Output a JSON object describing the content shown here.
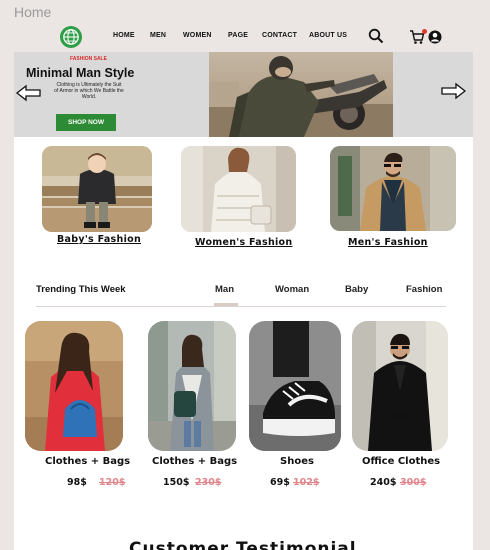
{
  "page_label": "Home",
  "nav": {
    "logo_icon": "globe-icon",
    "items": [
      "HOME",
      "MEN",
      "WOMEN",
      "PAGE",
      "CONTACT",
      "ABOUT US"
    ],
    "search_icon": "search-icon",
    "cart_icon": "cart-icon",
    "user_icon": "user-icon"
  },
  "hero": {
    "tag": "FASHION SALE",
    "title": "Minimal Man Style",
    "subtitle": "Clothing is Ultimately the Suit of Armor in which We Battle the World.",
    "button": "SHOP NOW",
    "prev_icon": "arrow-left-icon",
    "next_icon": "arrow-right-icon"
  },
  "categories": [
    "Baby's Fashion",
    "Women's Fashion",
    "Men's Fashion"
  ],
  "trending": {
    "title": "Trending This Week",
    "tabs": [
      "Man",
      "Woman",
      "Baby",
      "Fashion"
    ],
    "active_tab": "Man"
  },
  "products": [
    {
      "name": "Clothes + Bags",
      "price": "98$",
      "old_price": "120$"
    },
    {
      "name": "Clothes + Bags",
      "price": "150$",
      "old_price": "230$"
    },
    {
      "name": "Shoes",
      "price": "69$",
      "old_price": "102$"
    },
    {
      "name": "Office Clothes",
      "price": "240$",
      "old_price": "300$"
    }
  ],
  "footer_heading": "Customer Testimonial",
  "colors": {
    "background": "#ebe5e3",
    "hero_bg": "#d9d9d9",
    "accent_green": "#2e8b35",
    "sale_red": "#d92a2a",
    "old_price": "#e0878d"
  }
}
